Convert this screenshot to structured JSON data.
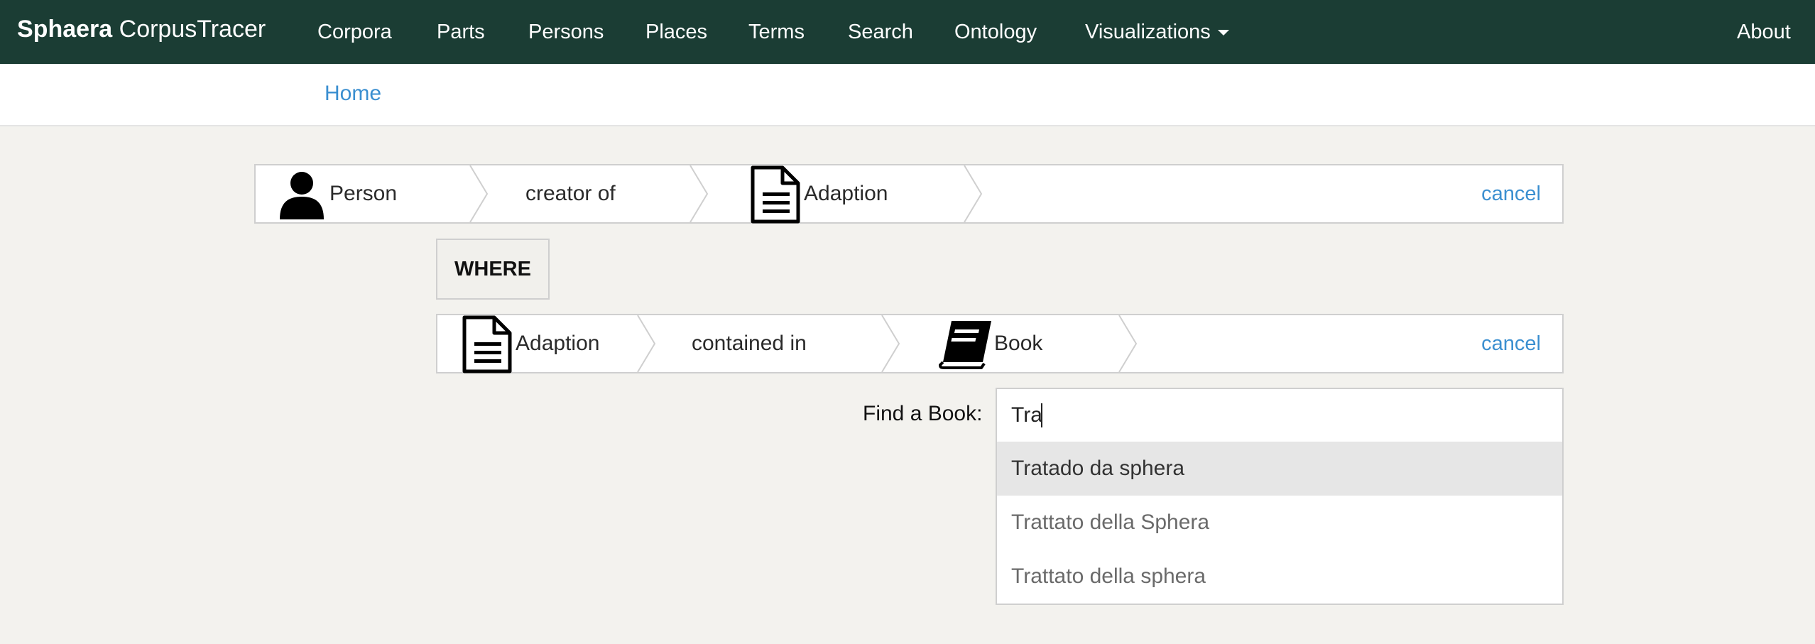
{
  "navbar": {
    "brand_primary": "Sphaera",
    "brand_secondary": "CorpusTracer",
    "items": [
      {
        "label": "Corpora"
      },
      {
        "label": "Parts"
      },
      {
        "label": "Persons"
      },
      {
        "label": "Places"
      },
      {
        "label": "Terms"
      },
      {
        "label": "Search"
      },
      {
        "label": "Ontology"
      },
      {
        "label": "Visualizations"
      }
    ],
    "about_label": "About",
    "color": "#1b3d34"
  },
  "breadcrumb": {
    "home_label": "Home"
  },
  "query": {
    "row1": {
      "subject": {
        "label": "Person",
        "icon": "person-icon"
      },
      "relation": {
        "label": "creator of"
      },
      "object": {
        "label": "Adaption",
        "icon": "document-icon"
      },
      "cancel_label": "cancel"
    },
    "where_label": "WHERE",
    "row2": {
      "subject": {
        "label": "Adaption",
        "icon": "document-icon"
      },
      "relation": {
        "label": "contained in"
      },
      "object": {
        "label": "Book",
        "icon": "book-icon"
      },
      "cancel_label": "cancel"
    }
  },
  "finder": {
    "label": "Find a Book:",
    "value": "Tra",
    "suggestions": [
      {
        "label": "Tratado da sphera"
      },
      {
        "label": "Trattato della Sphera"
      },
      {
        "label": "Trattato della sphera"
      }
    ]
  },
  "colors": {
    "link": "#3b8fd0",
    "background": "#f3f2ee"
  }
}
